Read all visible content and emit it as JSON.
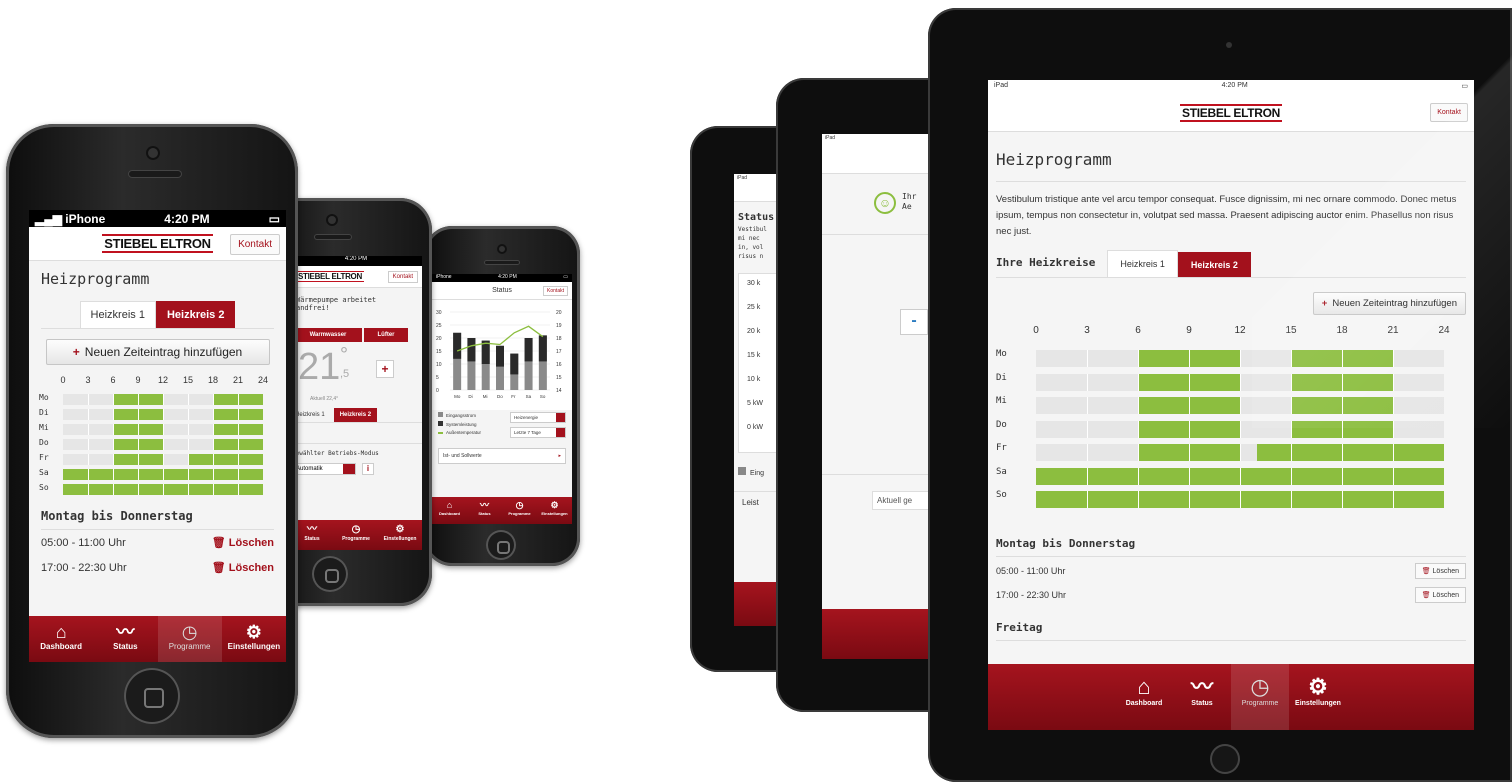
{
  "phone_main": {
    "status": {
      "carrier": "iPhone",
      "time": "4:20 PM"
    },
    "logo": "STIEBEL ELTRON",
    "kontakt": "Kontakt",
    "title": "Heizprogramm",
    "tabs": [
      "Heizkreis 1",
      "Heizkreis 2"
    ],
    "add_button": "Neuen Zeiteintrag hinzufügen",
    "hours": [
      "0",
      "3",
      "6",
      "9",
      "12",
      "15",
      "18",
      "21",
      "24"
    ],
    "days": [
      "Mo",
      "Di",
      "Mi",
      "Do",
      "Fr",
      "Sa",
      "So"
    ],
    "section_title": "Montag bis Donnerstag",
    "entries": [
      {
        "time": "05:00 - 11:00 Uhr",
        "action": "Löschen"
      },
      {
        "time": "17:00 - 22:30 Uhr",
        "action": "Löschen"
      }
    ],
    "nav": [
      "Dashboard",
      "Status",
      "Programme",
      "Einstellungen"
    ]
  },
  "phone_mid": {
    "time": "4:20 PM",
    "logo": "STIEBEL ELTRON",
    "kontakt": "Kontakt",
    "message": "Wärmepumpe arbeitet\nandfrei!",
    "buttons": [
      "Warmwasser",
      "Lüfter"
    ],
    "temp_big": "21",
    "temp_degree": "°",
    "temp_decimal": ",5",
    "current": "Aktuell 22,4°",
    "tabs": [
      "Heizkreis 1",
      "Heizkreis 2"
    ],
    "mode_title": "gewählter Betriebs-Modus",
    "mode_value": "Automatik",
    "nav": [
      "Status",
      "Programme",
      "Einstellungen"
    ]
  },
  "phone_small": {
    "carrier": "iPhone",
    "time": "4:20 PM",
    "title": "Status",
    "kontakt": "Kontakt",
    "y_left": [
      "30",
      "25",
      "20",
      "15",
      "10",
      "5",
      "0"
    ],
    "y_right": [
      "20",
      "19",
      "18",
      "17",
      "16",
      "15",
      "14"
    ],
    "days": [
      "Mo",
      "Di",
      "Mi",
      "Do",
      "Fr",
      "Sa",
      "So"
    ],
    "legend": [
      "Eingangsstrom",
      "Systemleistung",
      "Außentemperatur"
    ],
    "select1": "Heizenergie",
    "select2": "Letzte 7 Tage",
    "link": "Ist- und Sollwerte",
    "nav": [
      "Dashboard",
      "Status",
      "Programme",
      "Einstellungen"
    ]
  },
  "tablet_back": {
    "status": "iPad",
    "title": "Status",
    "text": [
      "Vestibul",
      "mi nec",
      "in, vol",
      "risus n"
    ],
    "y_labels": [
      "30 k",
      "25 k",
      "20 k",
      "15 k",
      "10 k",
      "5 kW",
      "0 kW"
    ],
    "legend": "Eing",
    "footer": "Leist"
  },
  "tablet_mid": {
    "status": "iPad",
    "message": [
      "Ihr",
      "Ae"
    ],
    "minus": "-",
    "current": "Aktuell ge"
  },
  "tablet_front": {
    "status": {
      "carrier": "iPad",
      "time": "4:20 PM"
    },
    "logo": "STIEBEL ELTRON",
    "kontakt": "Kontakt",
    "title": "Heizprogramm",
    "intro": "Vestibulum tristique ante vel arcu tempor consequat. Fusce dignissim, mi nec ornare commodo. Donec metus ipsum, tempus non consectetur in, volutpat sed massa. Praesent adipiscing auctor enim. Phasellus non risus nec just.",
    "circuits_label": "Ihre Heizkreise",
    "tabs": [
      "Heizkreis 1",
      "Heizkreis 2"
    ],
    "add_button": "Neuen Zeiteintrag hinzufügen",
    "hours": [
      "0",
      "3",
      "6",
      "9",
      "12",
      "15",
      "18",
      "21",
      "24"
    ],
    "days": [
      "Mo",
      "Di",
      "Mi",
      "Do",
      "Fr",
      "Sa",
      "So"
    ],
    "section1": "Montag bis Donnerstag",
    "entries": [
      {
        "time": "05:00 - 11:00 Uhr",
        "action": "Löschen"
      },
      {
        "time": "17:00 - 22:30 Uhr",
        "action": "Löschen"
      }
    ],
    "section2": "Freitag",
    "nav": [
      "Dashboard",
      "Status",
      "Programme",
      "Einstellungen"
    ]
  },
  "schedule": [
    {
      "day": "Mo",
      "blocks": [
        [
          6,
          12
        ],
        [
          18,
          24
        ]
      ]
    },
    {
      "day": "Di",
      "blocks": [
        [
          6,
          12
        ],
        [
          18,
          24
        ]
      ]
    },
    {
      "day": "Mi",
      "blocks": [
        [
          6,
          12
        ],
        [
          18,
          24
        ]
      ]
    },
    {
      "day": "Do",
      "blocks": [
        [
          6,
          12
        ],
        [
          18,
          24
        ]
      ]
    },
    {
      "day": "Fr",
      "blocks": [
        [
          6,
          12
        ],
        [
          15,
          24
        ]
      ]
    },
    {
      "day": "Sa",
      "blocks": [
        [
          0,
          24
        ]
      ]
    },
    {
      "day": "So",
      "blocks": [
        [
          0,
          24
        ]
      ]
    }
  ],
  "tablet_schedule": [
    {
      "day": "Mo",
      "blocks": [
        [
          6,
          12
        ],
        [
          15,
          21
        ]
      ]
    },
    {
      "day": "Di",
      "blocks": [
        [
          6,
          12
        ],
        [
          15,
          21
        ]
      ]
    },
    {
      "day": "Mi",
      "blocks": [
        [
          6,
          12
        ],
        [
          15,
          21
        ]
      ]
    },
    {
      "day": "Do",
      "blocks": [
        [
          6,
          12
        ],
        [
          15,
          21
        ]
      ]
    },
    {
      "day": "Fr",
      "blocks": [
        [
          6,
          12
        ],
        [
          13,
          24
        ]
      ]
    },
    {
      "day": "Sa",
      "blocks": [
        [
          0,
          24
        ]
      ]
    },
    {
      "day": "So",
      "blocks": [
        [
          0,
          24
        ]
      ]
    }
  ],
  "colors": {
    "brand_red": "#a3111c",
    "green": "#8cbe3f",
    "track": "#e6e6e6"
  }
}
